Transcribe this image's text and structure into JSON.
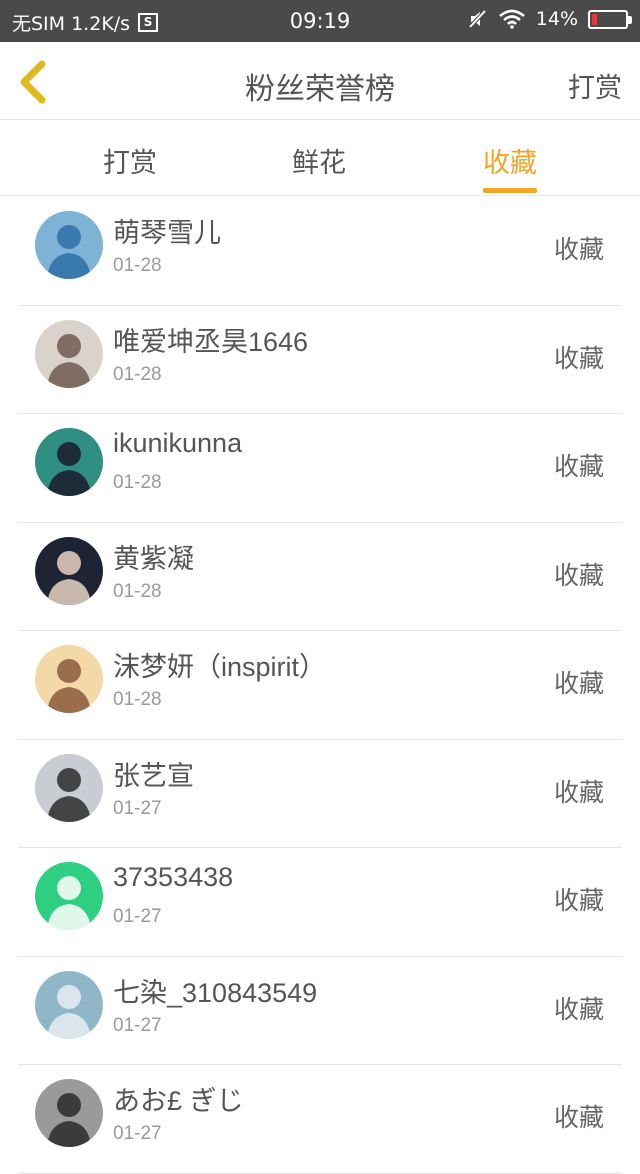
{
  "status_bar": {
    "left_text": "无SIM 1.2K/s",
    "sim_icon_glyph": "S",
    "time": "09:19",
    "battery_text": "14%",
    "battery_level": 0.14,
    "battery_color": "#e23b3b",
    "icons": [
      "mute-icon",
      "wifi-icon",
      "battery-icon"
    ]
  },
  "header": {
    "title": "粉丝荣誉榜",
    "action": "打赏",
    "back_icon": "chevron-left-icon",
    "back_icon_color": "#e0b820"
  },
  "tabs": [
    {
      "label": "打赏",
      "active": false
    },
    {
      "label": "鲜花",
      "active": false
    },
    {
      "label": "收藏",
      "active": true
    }
  ],
  "accent_color": "#f4a623",
  "rows": [
    {
      "name": "萌琴雪儿",
      "date": "01-28",
      "action": "收藏",
      "avatar": {
        "bg": "#7fb3d5",
        "fg": "#2e6fa7"
      }
    },
    {
      "name": "唯爱坤丞昊1646",
      "date": "01-28",
      "action": "收藏",
      "avatar": {
        "bg": "#d9d3cc",
        "fg": "#6e5a4e"
      }
    },
    {
      "name": "ikunikunna",
      "date": "01-28",
      "action": "收藏",
      "avatar": {
        "bg": "#2f8f83",
        "fg": "#1b1b2e"
      }
    },
    {
      "name": "黄紫凝",
      "date": "01-28",
      "action": "收藏",
      "avatar": {
        "bg": "#1e2433",
        "fg": "#e8d2c2"
      }
    },
    {
      "name": "沫梦妍（inspirit）",
      "date": "01-28",
      "action": "收藏",
      "avatar": {
        "bg": "#f4d9a8",
        "fg": "#8a5a3c"
      }
    },
    {
      "name": "张艺宣",
      "date": "01-27",
      "action": "收藏",
      "avatar": {
        "bg": "#c9ccd2",
        "fg": "#2b2b2b"
      }
    },
    {
      "name": "37353438",
      "date": "01-27",
      "action": "收藏",
      "avatar": {
        "bg": "#2fcf82",
        "fg": "#ffffff"
      }
    },
    {
      "name": "七染_310843549",
      "date": "01-27",
      "action": "收藏",
      "avatar": {
        "bg": "#8fb7c7",
        "fg": "#e9eef2"
      }
    },
    {
      "name": "あお£ ぎじ",
      "date": "01-27",
      "action": "收藏",
      "avatar": {
        "bg": "#9a9a9a",
        "fg": "#2a2a2a"
      }
    }
  ]
}
